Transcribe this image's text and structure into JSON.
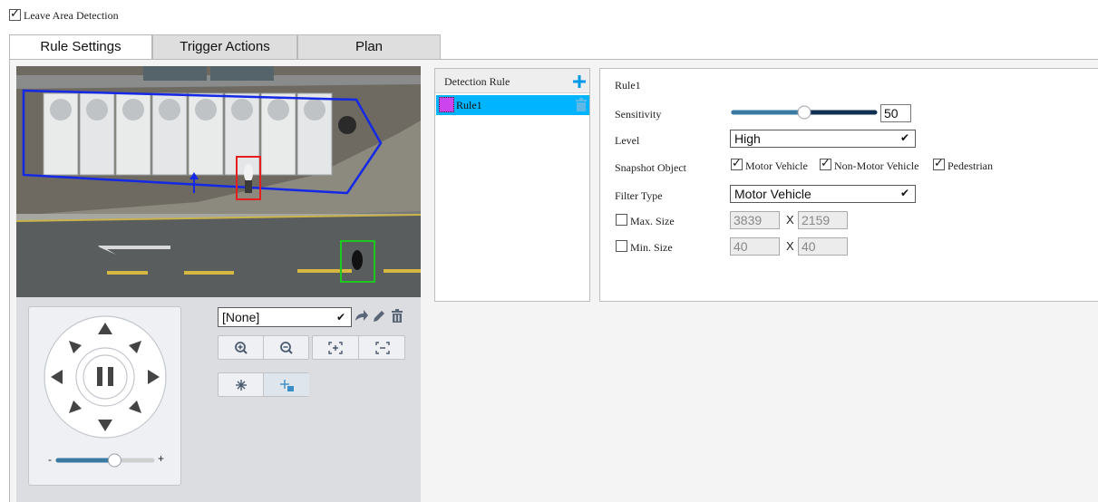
{
  "header": {
    "enable_checked": true,
    "enable_label": "Leave Area Detection"
  },
  "tabs": [
    {
      "label": "Rule Settings",
      "active": true
    },
    {
      "label": "Trigger Actions",
      "active": false
    },
    {
      "label": "Plan",
      "active": false
    }
  ],
  "ptz": {
    "preset_value": "[None]",
    "joystick_center_icon": "pause-icon",
    "zoom_slider_minus": "-",
    "zoom_slider_plus": "+",
    "zoom_slider_level": 0.6
  },
  "rule_list": {
    "header": "Detection Rule",
    "items": [
      {
        "name": "Rule1",
        "color": "#cc44ee",
        "selected": true
      }
    ]
  },
  "settings": {
    "rule_title": "Rule1",
    "sensitivity": {
      "label": "Sensitivity",
      "value": "50",
      "level": 0.5
    },
    "level": {
      "label": "Level",
      "value": "High"
    },
    "snapshot": {
      "label": "Snapshot Object",
      "options": [
        {
          "label": "Motor Vehicle",
          "checked": true
        },
        {
          "label": "Non-Motor Vehicle",
          "checked": true
        },
        {
          "label": "Pedestrian",
          "checked": true
        }
      ]
    },
    "filter_type": {
      "label": "Filter Type",
      "value": "Motor Vehicle"
    },
    "max_size": {
      "label": "Max. Size",
      "checked": false,
      "width": "3839",
      "sep": "X",
      "height": "2159"
    },
    "min_size": {
      "label": "Min. Size",
      "checked": false,
      "width": "40",
      "sep": "X",
      "height": "40"
    }
  },
  "colors": {
    "accent": "#0099e6",
    "selection": "#00b4ff",
    "detection_area": "#1428e6",
    "target_red": "#e61e1e",
    "target_green": "#1ec81e"
  }
}
